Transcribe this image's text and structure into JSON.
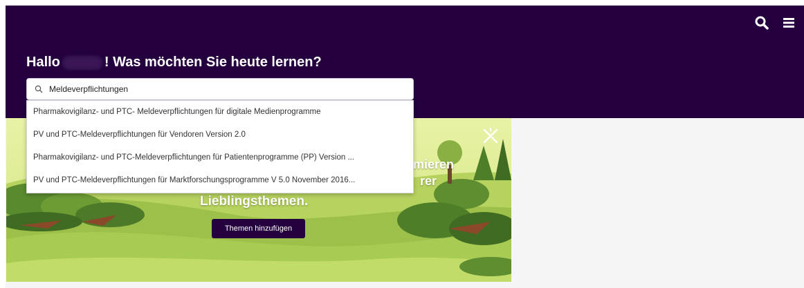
{
  "header": {
    "greeting_prefix": "Hallo",
    "greeting_suffix": "! Was möchten Sie heute lernen?",
    "search_icon": "search-icon",
    "menu_icon": "hamburger-menu-icon",
    "background_color": "#24003e"
  },
  "search": {
    "value": "Meldeverpflichtungen",
    "icon": "search-icon"
  },
  "suggestions": [
    "Pharmakovigilanz- und PTC- Meldeverpflichtungen für digitale Medienprogramme",
    "PV und PTC-Meldeverpflichtungen für Vendoren Version 2.0",
    "Pharmakovigilanz- und PTC-Meldeverpflichtungen für Patientenprogramme (PP) Version ...",
    "PV und PTC-Meldeverpflichtungen für Marktforschungsprogramme V 5.0 November 2016..."
  ],
  "banner": {
    "text_partial_1": "mieren",
    "text_partial_2": "rer",
    "text_line_3": "Lieblingsthemen.",
    "button_label": "Themen hinzufügen",
    "close_icon": "close-icon"
  }
}
